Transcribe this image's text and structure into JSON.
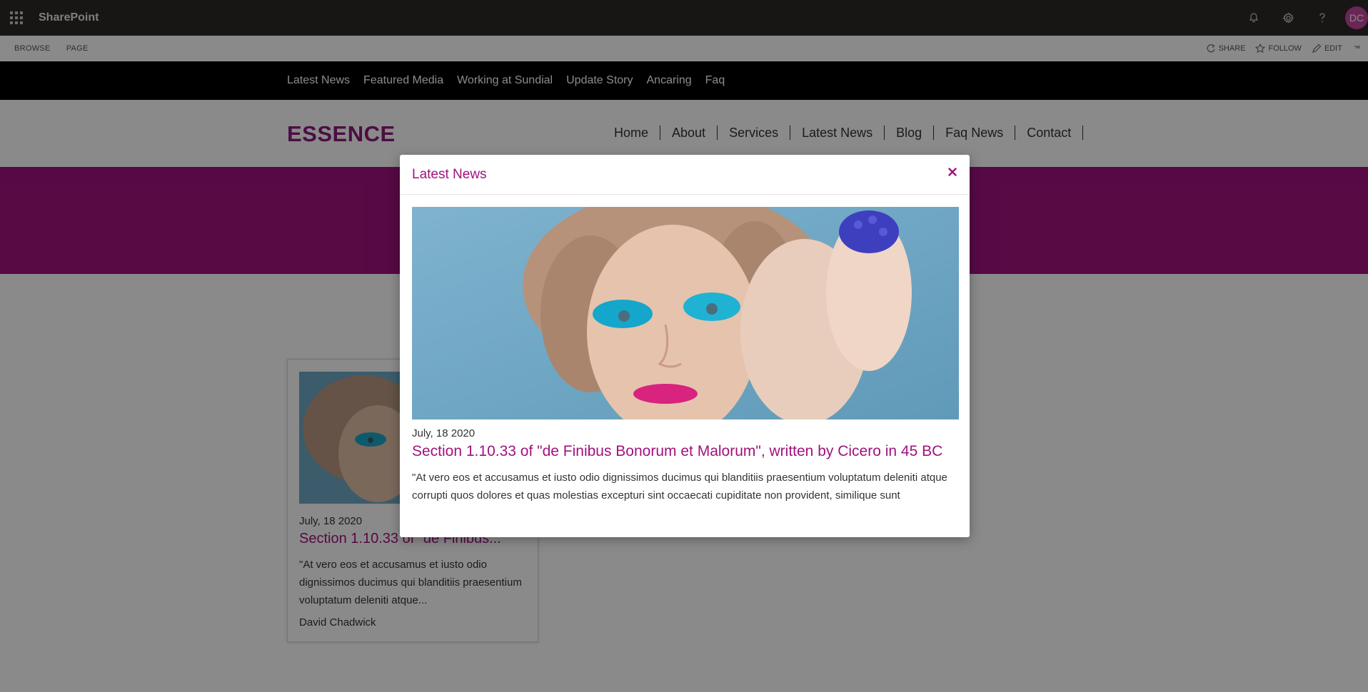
{
  "suite_bar": {
    "brand": "SharePoint",
    "avatar_initials": "DC",
    "avatar_color": "#c2479f",
    "icons": [
      "app-launcher-icon",
      "bell-icon",
      "gear-icon",
      "help-icon"
    ]
  },
  "ribbon": {
    "tabs": [
      "BROWSE",
      "PAGE"
    ],
    "actions": [
      "SHARE",
      "FOLLOW",
      "EDIT"
    ]
  },
  "top_nav": {
    "items": [
      "Latest News",
      "Featured Media",
      "Working at Sundial",
      "Update Story",
      "Ancaring",
      "Faq"
    ]
  },
  "site_header": {
    "logo": "ESSENCE",
    "nav": [
      "Home",
      "About",
      "Services",
      "Latest News",
      "Blog",
      "Faq News",
      "Contact"
    ]
  },
  "colors": {
    "accent": "#a0127e",
    "banner": "#a0127e",
    "top_nav_bg": "#000000",
    "suite_bar_bg": "#2b2a28"
  },
  "card": {
    "date": "July, 18 2020",
    "title": "Section 1.10.33 of \"de Finibus...",
    "excerpt": "\"At vero eos et accusamus et iusto odio dignissimos ducimus qui blanditiis praesentium voluptatum deleniti atque...",
    "author": "David Chadwick"
  },
  "modal": {
    "title": "Latest News",
    "close_icon": "close-icon",
    "date": "July, 18 2020",
    "headline": "Section 1.10.33 of \"de Finibus Bonorum et Malorum\", written by Cicero in 45 BC",
    "body": "\"At vero eos et accusamus et iusto odio dignissimos ducimus qui blanditiis praesentium voluptatum deleniti atque corrupti quos dolores et quas molestias excepturi sint occaecati cupiditate non provident, similique sunt"
  }
}
